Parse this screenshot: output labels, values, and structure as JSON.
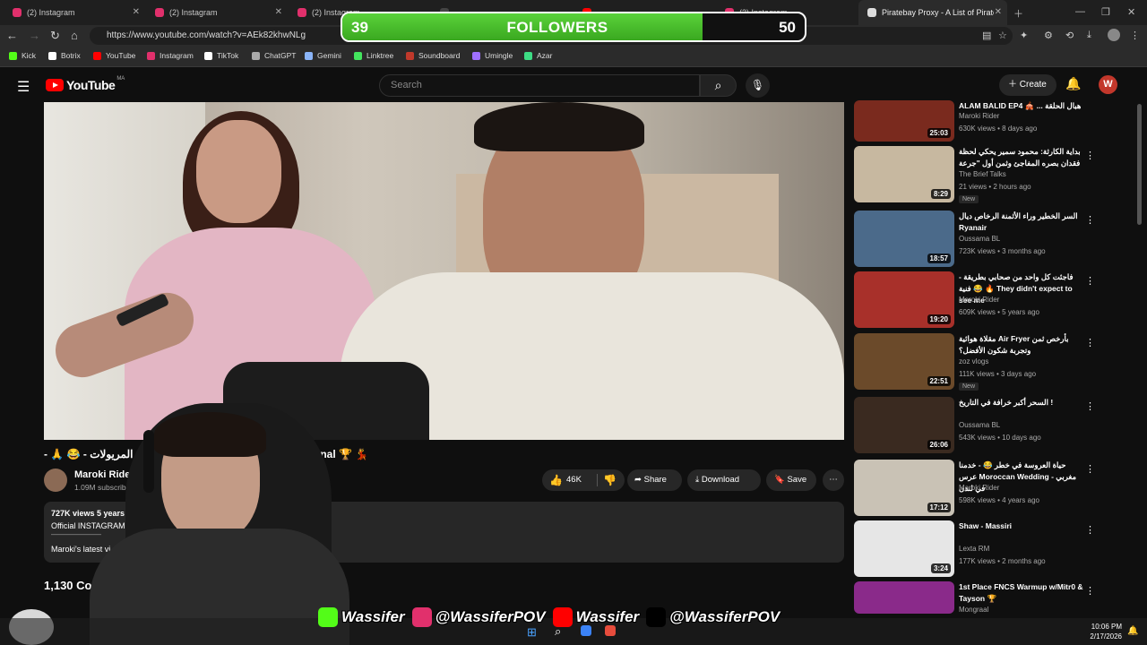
{
  "browser": {
    "tabs": [
      {
        "label": "(2) Instagram",
        "active": false
      },
      {
        "label": "(2) Instagram",
        "active": false
      },
      {
        "label": "(2) Instagram",
        "active": false
      },
      {
        "label": "",
        "active": false
      },
      {
        "label": "",
        "active": false
      },
      {
        "label": "(2) Instagram",
        "active": false
      },
      {
        "label": "Piratebay Proxy - A List of Pirate B",
        "active": true
      }
    ],
    "url": "https://www.youtube.com/watch?v=AEk82khwNLg",
    "bookmarks": [
      {
        "label": "Kick",
        "color": "#53fc18"
      },
      {
        "label": "Botrix",
        "color": "#ffffff"
      },
      {
        "label": "YouTube",
        "color": "#ff0000"
      },
      {
        "label": "Instagram",
        "color": "#e1306c"
      },
      {
        "label": "TikTok",
        "color": "#ffffff"
      },
      {
        "label": "ChatGPT",
        "color": "#aaaaaa"
      },
      {
        "label": "Gemini",
        "color": "#8ab4f8"
      },
      {
        "label": "Linktree",
        "color": "#43e55e"
      },
      {
        "label": "Soundboard",
        "color": "#c0392b"
      },
      {
        "label": "Umingle",
        "color": "#a070ff"
      },
      {
        "label": "Azar",
        "color": "#3ddc84"
      }
    ]
  },
  "followers_goal": {
    "current": "39",
    "label": "FOLLOWERS",
    "goal": "50",
    "progress": 0.78
  },
  "youtube": {
    "logo": "YouTube",
    "country": "MA",
    "search_placeholder": "Search",
    "create_label": "Create",
    "avatar_letter": "W",
    "video": {
      "title_start": "لقاء المريولات - 😂 🙏 -",
      "title_end": "inal 🏆 💃",
      "channel": "Maroki Rider",
      "subscribers": "1.09M subscribers",
      "likes": "46K",
      "share_label": "Share",
      "download_label": "Download",
      "save_label": "Save",
      "desc_stats": "727K views  5 years ag",
      "desc_line2": "Official INSTAGRAM : ",
      "desc_line3": "———————",
      "desc_line4": "Maroki's latest vi",
      "comments": "1,130 Co"
    },
    "recommendations": [
      {
        "title": "ALAM BALID EP4 🎪 ... هبال الحلقة",
        "channel": "Maroki Rider",
        "meta": "630K views • 8 days ago",
        "duration": "25:03",
        "badge": ""
      },
      {
        "title": "بداية الكارثة: محمود سمير يحكي لحظة فقدان بصره المفاجئ وثمن أول \"جرعة",
        "channel": "The Brief Talks",
        "meta": "21 views • 2 hours ago",
        "duration": "8:29",
        "badge": "New"
      },
      {
        "title": "السر الخطير وراء الأثمنة الرخاص ديال Ryanair",
        "channel": "Oussama BL",
        "meta": "723K views • 3 months ago",
        "duration": "18:57",
        "badge": ""
      },
      {
        "title": "- فاجئت كل واحد من صحابي بطريقة فنية 😂 🔥 They didn't expect to see me",
        "channel": "Maroki Rider",
        "meta": "609K views • 5 years ago",
        "duration": "19:20",
        "badge": ""
      },
      {
        "title": "مقلاة هوائية Air Fryer بأرخص ثمن وتجربة شكون الأفضل؟",
        "channel": "zoz vlogs",
        "meta": "111K views • 3 days ago",
        "duration": "22:51",
        "badge": "New"
      },
      {
        "title": "السحر أكبر خرافة في التاريخ !",
        "channel": "Oussama BL",
        "meta": "543K views • 10 days ago",
        "duration": "26:06",
        "badge": ""
      },
      {
        "title": "حياة العروسة في خطر 😂 - خدمنا عرس Moroccan Wedding - مغربي في لندن",
        "channel": "Maroki Rider",
        "meta": "598K views • 4 years ago",
        "duration": "17:12",
        "badge": ""
      },
      {
        "title": "Shaw - Massiri",
        "channel": "Lexta RM",
        "meta": "177K views • 2 months ago",
        "duration": "3:24",
        "badge": ""
      },
      {
        "title": "1st Place FNCS Warmup w/Mitr0 & Tayson 🏆",
        "channel": "Mongraal",
        "meta": "",
        "duration": "",
        "badge": ""
      }
    ]
  },
  "socials": [
    {
      "label": "Wassifer",
      "icon": "kick-icon",
      "color": "#53fc18"
    },
    {
      "label": "@WassiferPOV",
      "icon": "instagram-icon",
      "color": "#e1306c"
    },
    {
      "label": "Wassifer",
      "icon": "youtube-icon",
      "color": "#ff0000"
    },
    {
      "label": "@WassiferPOV",
      "icon": "tiktok-icon",
      "color": "#000000"
    }
  ],
  "taskbar": {
    "time": "10:06 PM",
    "date": "2/17/2026"
  }
}
